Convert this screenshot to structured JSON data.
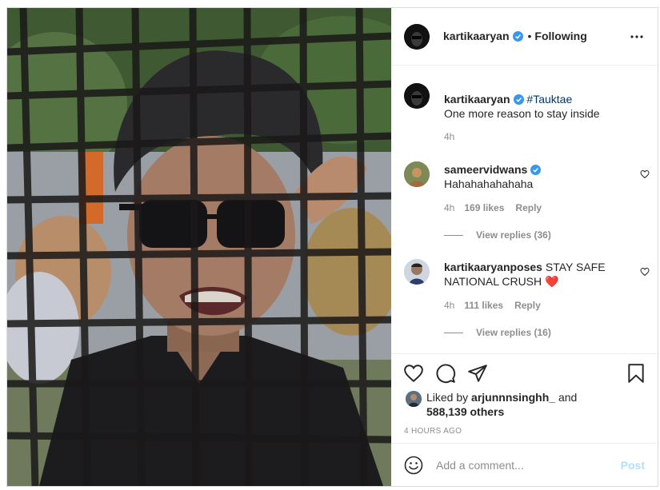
{
  "header": {
    "username": "kartikaaryan",
    "separator": "•",
    "follow_status": "Following",
    "more_icon": "more-horizontal-icon"
  },
  "caption": {
    "username": "kartikaaryan",
    "hashtag": "#Tauktae",
    "text": "One more reason to stay inside",
    "time": "4h"
  },
  "comments": [
    {
      "username": "sameervidwans",
      "verified": true,
      "text": "Hahahahahahaha",
      "time": "4h",
      "likes": "169 likes",
      "reply": "Reply",
      "view_replies": "View replies (36)"
    },
    {
      "username": "kartikaaryanposes",
      "verified": false,
      "text": "STAY SAFE NATIONAL CRUSH ❤️",
      "time": "4h",
      "likes": "111 likes",
      "reply": "Reply",
      "view_replies": "View replies (16)"
    }
  ],
  "actions": {
    "icons": [
      "heart-icon",
      "comment-icon",
      "share-icon",
      "bookmark-icon"
    ],
    "liked_by_prefix": "Liked by",
    "liked_by_user": "arjunnnsinghh_",
    "liked_by_and": "and",
    "liked_by_others": "588,139 others",
    "timestamp": "4 HOURS AGO"
  },
  "add_comment": {
    "placeholder": "Add a comment...",
    "post_label": "Post"
  },
  "colors": {
    "verified_blue": "#3897f0",
    "hashtag": "#00376b",
    "muted": "#8e8e8e",
    "post_disabled": "#b2dffc",
    "heart_red": "#ed4956"
  }
}
